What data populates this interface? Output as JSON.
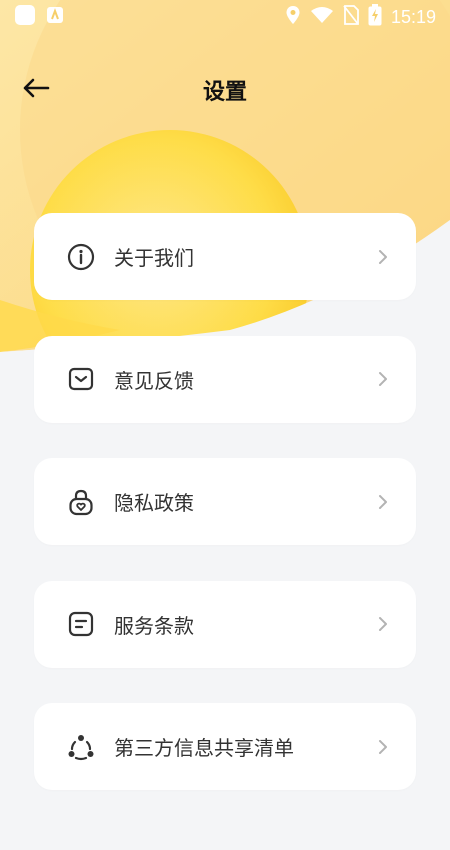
{
  "status_bar": {
    "time": "15:19",
    "icons": [
      "app-icon",
      "notification-icon",
      "location-icon",
      "wifi-icon",
      "no-sim-icon",
      "battery-charging-icon"
    ]
  },
  "header": {
    "title": "设置",
    "back_icon": "arrow-left-icon"
  },
  "menu": {
    "items": [
      {
        "label": "关于我们",
        "icon": "info-icon"
      },
      {
        "label": "意见反馈",
        "icon": "feedback-icon"
      },
      {
        "label": "隐私政策",
        "icon": "privacy-lock-icon"
      },
      {
        "label": "服务条款",
        "icon": "terms-document-icon"
      },
      {
        "label": "第三方信息共享清单",
        "icon": "share-icon"
      }
    ]
  },
  "colors": {
    "background": "#f4f5f7",
    "accent_yellow": "#ffd84a",
    "card": "#ffffff",
    "text": "#333333",
    "icon": "#333333",
    "chevron": "#b3b3b3"
  }
}
